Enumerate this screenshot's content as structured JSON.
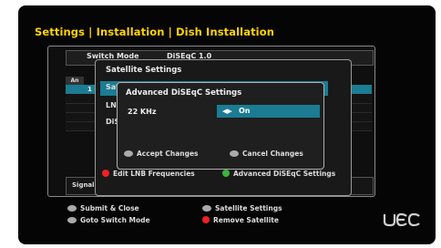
{
  "header": {
    "title": "Settings | Installation | Dish Installation"
  },
  "dish": {
    "switch_mode_label": "Switch Mode",
    "switch_mode_value": "DiSEqC 1.0",
    "column_header": "An",
    "selected_row_number": "1",
    "signal_label": "Signal"
  },
  "satellite_panel": {
    "title": "Satellite Settings",
    "rows": [
      "Sat",
      "LNB",
      "DiS"
    ],
    "edit_lnb_label": "Edit LNB Frequencies",
    "advanced_label": "Advanced DiSEqC Settings"
  },
  "advanced_dialog": {
    "title": "Advanced DiSEqC Settings",
    "khz_label": "22 KHz",
    "khz_value": "On",
    "accept_label": "Accept Changes",
    "cancel_label": "Cancel Changes"
  },
  "footer": {
    "submit_close": "Submit & Close",
    "goto_switch": "Goto Switch Mode",
    "satellite_settings": "Satellite Settings",
    "remove_satellite": "Remove Satellite"
  },
  "brand": {
    "logo_text": "UEC"
  },
  "colors": {
    "title": "#ffd400",
    "highlight": "#1b7c93",
    "red": "#e22222",
    "green": "#3cb33c"
  }
}
